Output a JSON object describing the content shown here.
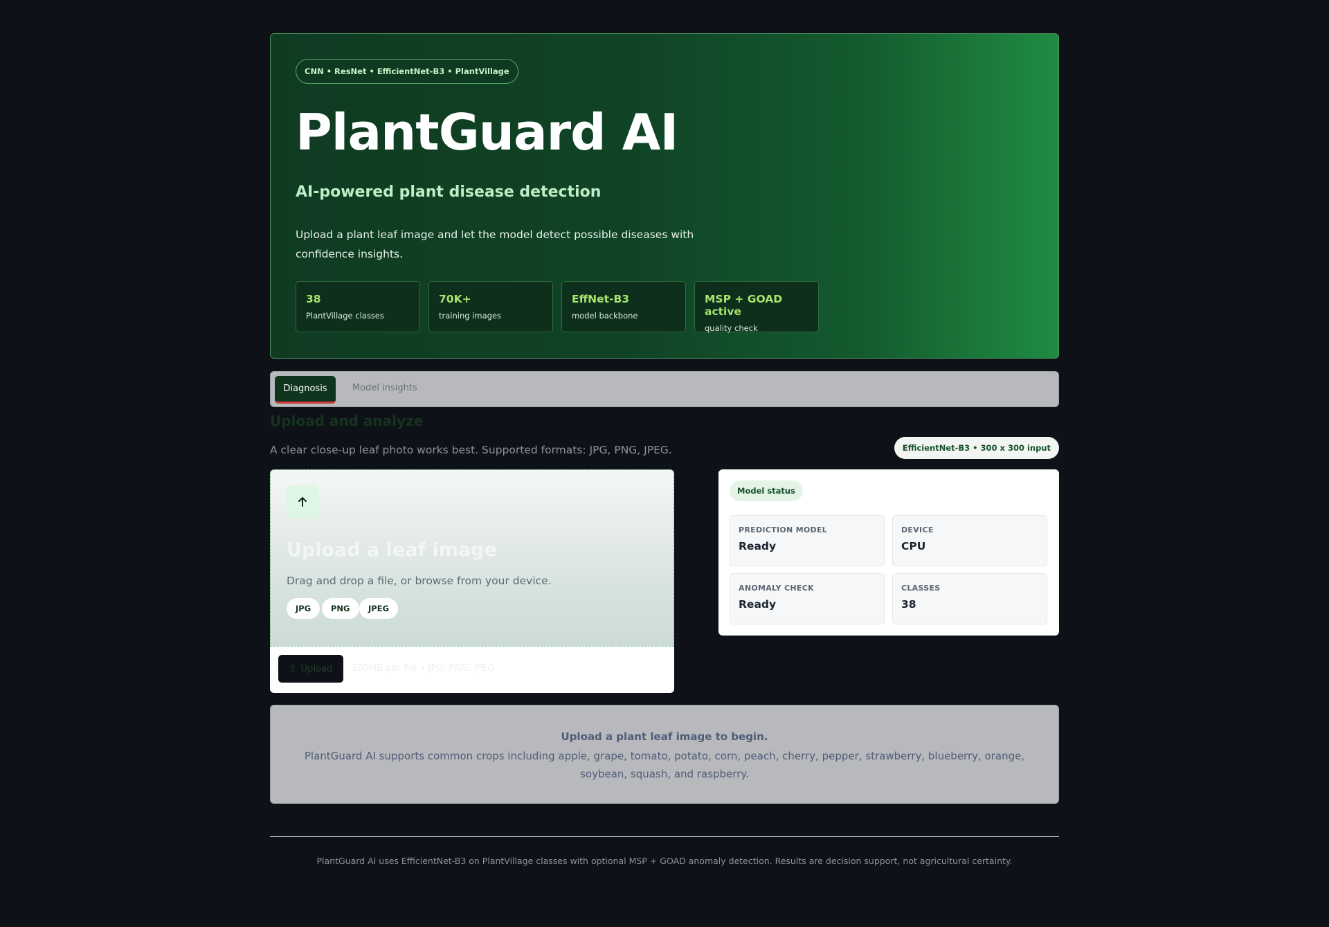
{
  "hero": {
    "tag": "CNN • ResNet • EfficientNet-B3 • PlantVillage",
    "title": "PlantGuard AI",
    "subtitle": "AI-powered plant disease detection",
    "description": "Upload a plant leaf image and let the model detect possible diseases with confidence insights.",
    "stats": [
      {
        "value": "38",
        "label": "PlantVillage classes"
      },
      {
        "value": "70K+",
        "label": "training images"
      },
      {
        "value": "EffNet-B3",
        "label": "model backbone"
      },
      {
        "value": "MSP + GOAD active",
        "label": "quality check"
      }
    ]
  },
  "tabs": {
    "diagnosis": "Diagnosis",
    "insights": "Model insights"
  },
  "section": {
    "title": "Upload and analyze",
    "subtitle": "A clear close-up leaf photo works best. Supported formats: JPG, PNG, JPEG.",
    "model_badge": "EfficientNet-B3 • 300 x 300 input"
  },
  "upload": {
    "icon": "arrow-up-icon",
    "title": "Upload a leaf image",
    "subtitle": "Drag and drop a file, or browse from your device.",
    "formats": [
      "JPG",
      "PNG",
      "JPEG"
    ],
    "button_label": "Upload",
    "hint": "200MB per file • JPG, PNG, JPEG"
  },
  "status": {
    "pill": "Model status",
    "items": [
      {
        "key": "PREDICTION MODEL",
        "value": "Ready"
      },
      {
        "key": "DEVICE",
        "value": "CPU"
      },
      {
        "key": "ANOMALY CHECK",
        "value": "Ready"
      },
      {
        "key": "CLASSES",
        "value": "38"
      }
    ]
  },
  "info": {
    "heading": "Upload a plant leaf image to begin.",
    "text": "PlantGuard AI supports common crops including apple, grape, tomato, potato, corn, peach, cherry, pepper, strawberry, blueberry, orange, soybean, squash, and raspberry."
  },
  "footer": "PlantGuard AI uses EfficientNet-B3 on PlantVillage classes with optional MSP + GOAD anomaly detection. Results are decision support, not agricultural certainty."
}
